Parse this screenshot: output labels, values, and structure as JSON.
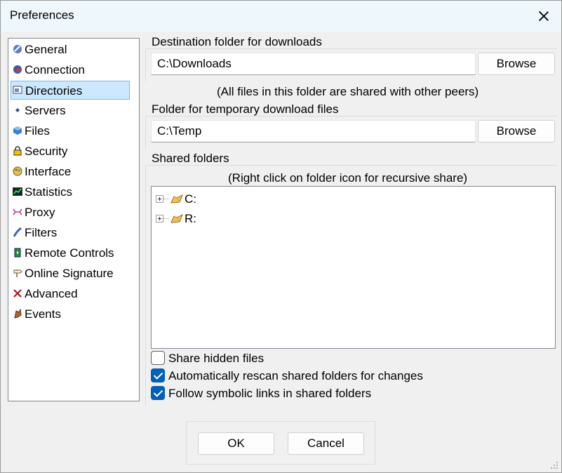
{
  "window": {
    "title": "Preferences"
  },
  "nav": {
    "items": [
      {
        "label": "General",
        "icon": "general-icon"
      },
      {
        "label": "Connection",
        "icon": "connection-icon"
      },
      {
        "label": "Directories",
        "icon": "directories-icon",
        "selected": true
      },
      {
        "label": "Servers",
        "icon": "servers-icon"
      },
      {
        "label": "Files",
        "icon": "files-icon"
      },
      {
        "label": "Security",
        "icon": "lock-icon"
      },
      {
        "label": "Interface",
        "icon": "interface-icon"
      },
      {
        "label": "Statistics",
        "icon": "statistics-icon"
      },
      {
        "label": "Proxy",
        "icon": "proxy-icon"
      },
      {
        "label": "Filters",
        "icon": "filters-icon"
      },
      {
        "label": "Remote Controls",
        "icon": "remote-controls-icon"
      },
      {
        "label": "Online Signature",
        "icon": "signpost-icon"
      },
      {
        "label": "Advanced",
        "icon": "advanced-icon"
      },
      {
        "label": "Events",
        "icon": "events-icon"
      }
    ]
  },
  "downloads": {
    "label": "Destination folder for downloads",
    "value": "C:\\Downloads",
    "browse_label": "Browse",
    "note": "(All files in this folder are shared with other peers)"
  },
  "temp": {
    "label": "Folder for temporary download files",
    "value": "C:\\Temp",
    "browse_label": "Browse"
  },
  "shared": {
    "label": "Shared folders",
    "note": "(Right click on folder icon for recursive share)",
    "tree": [
      {
        "label": "C:"
      },
      {
        "label": "R:"
      }
    ]
  },
  "options": {
    "share_hidden": {
      "label": "Share hidden files",
      "checked": false
    },
    "auto_rescan": {
      "label": "Automatically rescan shared folders for changes",
      "checked": true
    },
    "follow_links": {
      "label": "Follow symbolic links in shared folders",
      "checked": true
    }
  },
  "buttons": {
    "ok": "OK",
    "cancel": "Cancel"
  },
  "colors": {
    "accent": "#005fb8",
    "selection": "#cce8ff",
    "titlebar": "#eef7fb"
  }
}
